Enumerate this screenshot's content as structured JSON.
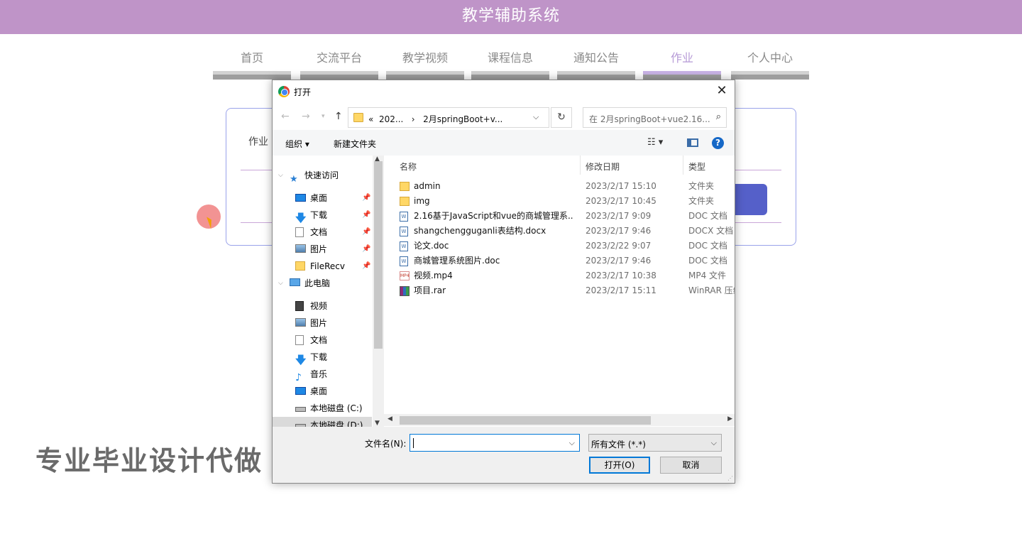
{
  "app": {
    "title": "教学辅助系统"
  },
  "nav": [
    {
      "label": "首页",
      "active": false
    },
    {
      "label": "交流平台",
      "active": false
    },
    {
      "label": "教学视频",
      "active": false
    },
    {
      "label": "课程信息",
      "active": false
    },
    {
      "label": "通知公告",
      "active": false
    },
    {
      "label": "作业",
      "active": true
    },
    {
      "label": "个人中心",
      "active": false
    }
  ],
  "form": {
    "label": "作业"
  },
  "watermark": "专业毕业设计代做",
  "dialog": {
    "title": "打开",
    "breadcrumb": [
      "«",
      "202...",
      "›",
      "2月springBoot+v..."
    ],
    "search_placeholder": "在 2月springBoot+vue2.16...",
    "toolbar": {
      "organize": "组织 ▾",
      "new_folder": "新建文件夹"
    },
    "sidebar": [
      {
        "label": "快速访问",
        "icon": "star-icon",
        "level": 0,
        "pinned": false
      },
      {
        "label": "桌面",
        "icon": "desktop-icon",
        "level": 1,
        "pinned": true
      },
      {
        "label": "下载",
        "icon": "download-icon",
        "level": 1,
        "pinned": true
      },
      {
        "label": "文档",
        "icon": "document-icon",
        "level": 1,
        "pinned": true
      },
      {
        "label": "图片",
        "icon": "picture-icon",
        "level": 1,
        "pinned": true
      },
      {
        "label": "FileRecv",
        "icon": "folder-icon",
        "level": 1,
        "pinned": true
      },
      {
        "label": "此电脑",
        "icon": "computer-icon",
        "level": 0,
        "pinned": false
      },
      {
        "label": "视频",
        "icon": "video-icon",
        "level": 1,
        "pinned": false
      },
      {
        "label": "图片",
        "icon": "picture-icon",
        "level": 1,
        "pinned": false
      },
      {
        "label": "文档",
        "icon": "document-icon",
        "level": 1,
        "pinned": false
      },
      {
        "label": "下载",
        "icon": "download-icon",
        "level": 1,
        "pinned": false
      },
      {
        "label": "音乐",
        "icon": "music-icon",
        "level": 1,
        "pinned": false
      },
      {
        "label": "桌面",
        "icon": "desktop-icon",
        "level": 1,
        "pinned": false
      },
      {
        "label": "本地磁盘 (C:)",
        "icon": "drive-icon",
        "level": 1,
        "pinned": false
      },
      {
        "label": "本地磁盘 (D:)",
        "icon": "drive-icon",
        "level": 1,
        "pinned": false,
        "selected": true
      }
    ],
    "columns": {
      "name": "名称",
      "date": "修改日期",
      "type": "类型"
    },
    "files": [
      {
        "name": "admin",
        "date": "2023/2/17 15:10",
        "type": "文件夹",
        "icon": "folder-icon"
      },
      {
        "name": "img",
        "date": "2023/2/17 10:45",
        "type": "文件夹",
        "icon": "folder-icon"
      },
      {
        "name": "2.16基于JavaScript和vue的商城管理系...",
        "date": "2023/2/17 9:09",
        "type": "DOC 文档",
        "icon": "word-doc-icon"
      },
      {
        "name": "shangchengguganli表结构.docx",
        "date": "2023/2/17 9:46",
        "type": "DOCX 文档",
        "icon": "word-doc-icon"
      },
      {
        "name": "论文.doc",
        "date": "2023/2/22 9:07",
        "type": "DOC 文档",
        "icon": "word-doc-icon"
      },
      {
        "name": "商城管理系统图片.doc",
        "date": "2023/2/17 9:46",
        "type": "DOC 文档",
        "icon": "word-doc-icon"
      },
      {
        "name": "视频.mp4",
        "date": "2023/2/17 10:38",
        "type": "MP4 文件",
        "icon": "video-file-icon"
      },
      {
        "name": "项目.rar",
        "date": "2023/2/17 15:11",
        "type": "WinRAR 压缩",
        "icon": "rar-archive-icon"
      }
    ],
    "filename_label": "文件名(N):",
    "filename_value": "",
    "filetype": "所有文件 (*.*)",
    "open_button": "打开(O)",
    "cancel_button": "取消"
  },
  "colors": {
    "header": "#bf94c8",
    "accent": "#5560c9",
    "focus": "#0078d7"
  }
}
